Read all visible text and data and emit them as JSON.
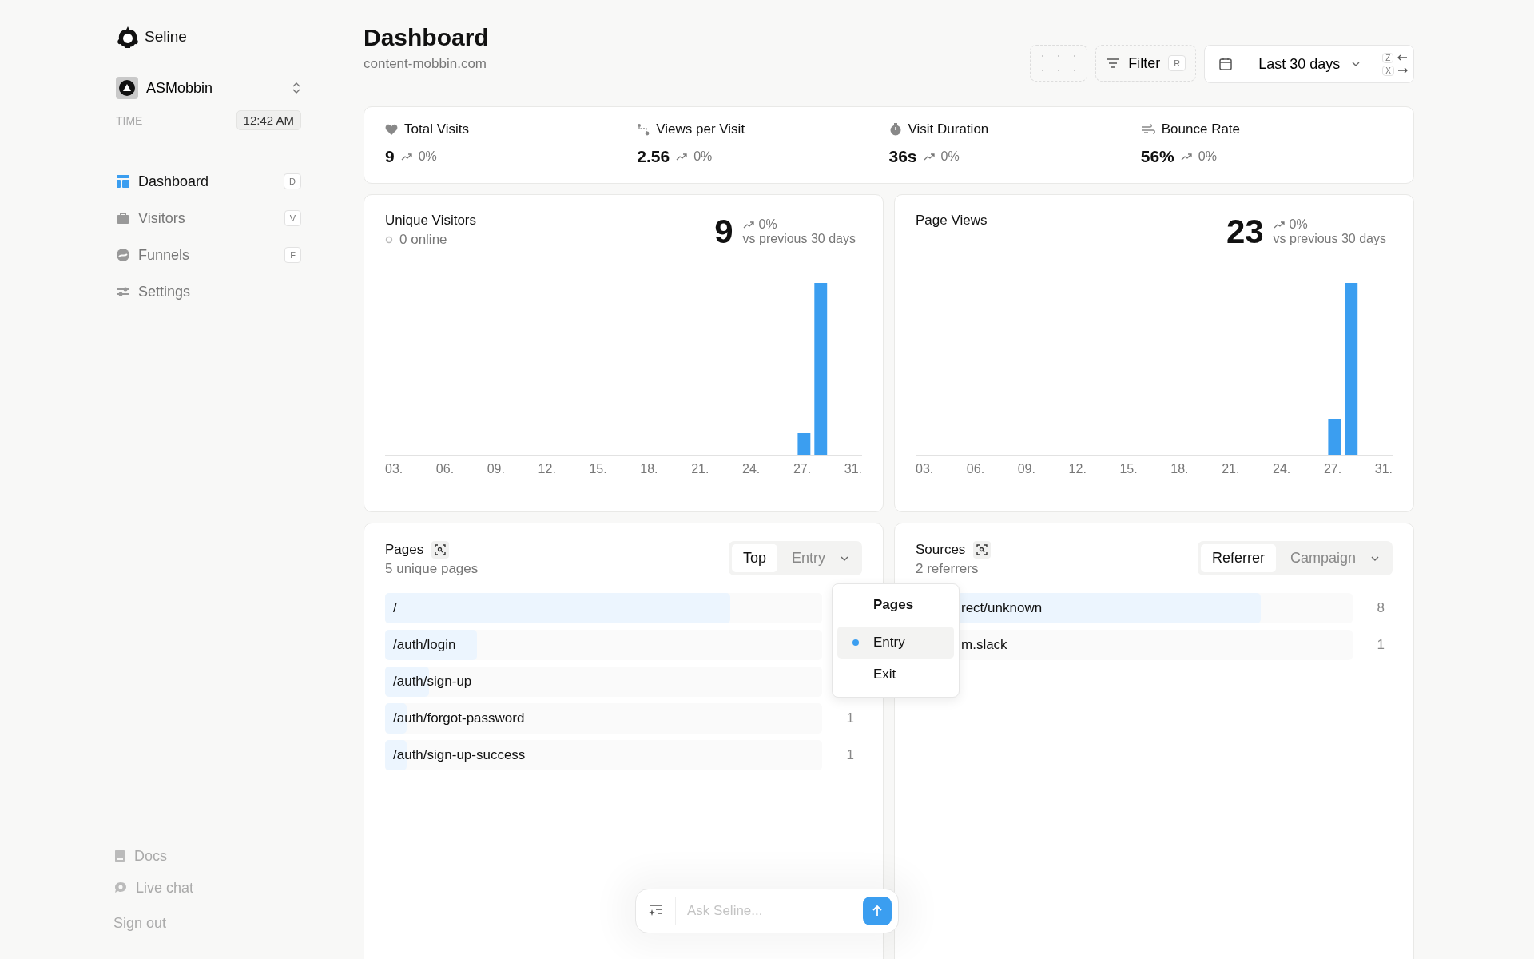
{
  "app": {
    "name": "Seline"
  },
  "project": {
    "name": "ASMobbin"
  },
  "time": {
    "label": "TIME",
    "value": "12:42 AM"
  },
  "nav": [
    {
      "label": "Dashboard",
      "shortcut": "D",
      "selected": true,
      "kind": "dashboard"
    },
    {
      "label": "Visitors",
      "shortcut": "V",
      "selected": false,
      "kind": "visitors"
    },
    {
      "label": "Funnels",
      "shortcut": "F",
      "selected": false,
      "kind": "funnels"
    },
    {
      "label": "Settings",
      "selected": false,
      "kind": "settings"
    }
  ],
  "footer_links": [
    {
      "label": "Docs",
      "kind": "docs"
    },
    {
      "label": "Live chat",
      "kind": "chat"
    }
  ],
  "sign_out": "Sign out",
  "header": {
    "title": "Dashboard",
    "domain": "content-mobbin.com",
    "filter": {
      "label": "Filter",
      "shortcut": "R"
    },
    "range": {
      "label": "Last 30 days"
    },
    "nav_keys": [
      {
        "key": "Z",
        "kind": "prev"
      },
      {
        "key": "X",
        "kind": "next"
      }
    ]
  },
  "metrics": [
    {
      "label": "Total Visits",
      "value": "9",
      "change": "0%",
      "kind": "visits"
    },
    {
      "label": "Views per Visit",
      "value": "2.56",
      "change": "0%",
      "kind": "views"
    },
    {
      "label": "Visit Duration",
      "value": "36s",
      "change": "0%",
      "kind": "duration"
    },
    {
      "label": "Bounce Rate",
      "value": "56%",
      "change": "0%",
      "kind": "bounce"
    }
  ],
  "charts": [
    {
      "title": "Unique Visitors",
      "online": "0 online",
      "value": "9",
      "change": "0%",
      "comparison": "vs previous 30 days",
      "x_labels": [
        "03.",
        "06.",
        "09.",
        "12.",
        "15.",
        "18.",
        "21.",
        "24.",
        "27.",
        "31."
      ]
    },
    {
      "title": "Page Views",
      "value": "23",
      "change": "0%",
      "comparison": "vs previous 30 days",
      "x_labels": [
        "03.",
        "06.",
        "09.",
        "12.",
        "15.",
        "18.",
        "21.",
        "24.",
        "27.",
        "31."
      ]
    }
  ],
  "pages": {
    "title": "Pages",
    "subtitle": "5 unique pages",
    "tabs": [
      {
        "label": "Top",
        "selected": true
      },
      {
        "label": "Entry",
        "selected": false
      }
    ],
    "rows": [
      {
        "label": "/",
        "level": 0.79
      },
      {
        "label": "/auth/login",
        "level": 0.21
      },
      {
        "label": "/auth/sign-up",
        "level": 0.1
      },
      {
        "label": "/auth/forgot-password",
        "level": 0.05,
        "count": "1"
      },
      {
        "label": "/auth/sign-up-success",
        "level": 0.05,
        "count": "1"
      }
    ]
  },
  "sources": {
    "title": "Sources",
    "subtitle": "2 referrers",
    "tabs": [
      {
        "label": "Referrer",
        "selected": true
      },
      {
        "label": "Campaign",
        "selected": false
      }
    ],
    "rows": [
      {
        "label": "rect/unknown",
        "level": 0.79,
        "count": "8"
      },
      {
        "label": "m.slack",
        "count": "1"
      }
    ]
  },
  "menu": {
    "title": "Pages",
    "items": [
      {
        "label": "Entry",
        "selected": true
      },
      {
        "label": "Exit",
        "selected": false
      }
    ]
  },
  "chat": {
    "placeholder": "Ask Seline..."
  }
}
